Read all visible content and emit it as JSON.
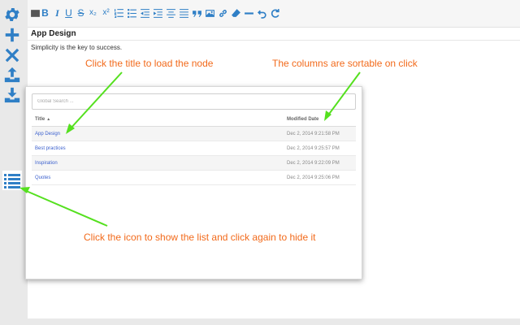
{
  "sidebar": {
    "icons": [
      "gear-icon",
      "plus-icon",
      "close-icon",
      "upload-icon",
      "download-icon",
      "list-icon"
    ]
  },
  "toolbar": {
    "bold": "B",
    "italic": "I",
    "underline": "U",
    "strike": "S",
    "subscript": "x₂",
    "superscript": "x²"
  },
  "document": {
    "title": "App Design",
    "body": "Simplicity is the key to success."
  },
  "list_panel": {
    "search_placeholder": "Global Search ...",
    "columns": {
      "title": "Title",
      "modified": "Modified Date",
      "sort_indicator": "▲"
    },
    "rows": [
      {
        "title": "App Design",
        "modified": "Dec 2, 2014 9:21:58 PM"
      },
      {
        "title": "Best practices",
        "modified": "Dec 2, 2014 9:25:57 PM"
      },
      {
        "title": "Inspiration",
        "modified": "Dec 2, 2014 9:22:09 PM"
      },
      {
        "title": "Quotes",
        "modified": "Dec 2, 2014 9:25:06 PM"
      }
    ]
  },
  "annotations": {
    "title_note": "Click the title to load the node",
    "sort_note": "The columns are sortable on click",
    "icon_note": "Click the icon to show the list and click again to hide it"
  },
  "colors": {
    "accent": "#2f7fc6",
    "annotation_text": "#f26a1b",
    "annotation_arrow": "#55e01f",
    "link": "#3a5fcd"
  }
}
